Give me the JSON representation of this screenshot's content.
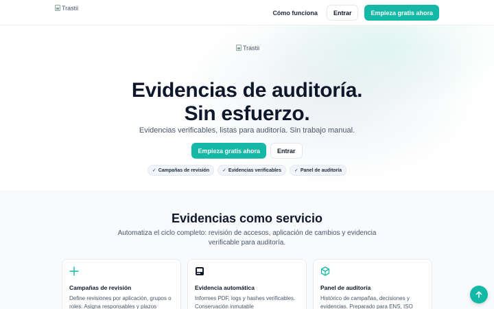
{
  "header": {
    "logo_alt": "Trastii",
    "nav_how": "Cómo funciona",
    "nav_login": "Entrar",
    "nav_cta": "Empieza gratis ahora"
  },
  "hero": {
    "logo_alt": "Trastii",
    "title_line1": "Evidencias de auditoría.",
    "title_line2": "Sin esfuerzo.",
    "subtitle": "Evidencias verificables, listas para auditoría. Sin trabajo manual.",
    "cta_primary": "Empieza gratis ahora",
    "cta_secondary": "Entrar",
    "chips": [
      "Campañas de revisión",
      "Evidencias verificables",
      "Panel de auditoría"
    ]
  },
  "features": {
    "title": "Evidencias como servicio",
    "description": "Automatiza el ciclo completo: revisión de accesos, aplicación de cambios y evidencia verificable para auditoría.",
    "cards": [
      {
        "icon": "plus-icon",
        "title": "Campañas de revisión",
        "description": "Define revisiones por aplicación, grupos o roles. Asigna responsables y plazos"
      },
      {
        "icon": "document-icon",
        "title": "Evidencia automática",
        "description": "Informes PDF, logs y hashes verificables. Conservación inmutable"
      },
      {
        "icon": "cube-icon",
        "title": "Panel de auditoría",
        "description": "Histórico de campañas, decisiones y evidencias. Preparado para ENS, ISO"
      }
    ]
  },
  "fab": {
    "icon": "arrow-up-icon"
  },
  "colors": {
    "accent": "#14b8a6",
    "text": "#0f172a",
    "muted": "#475569",
    "section_bg": "#f8fafc"
  }
}
